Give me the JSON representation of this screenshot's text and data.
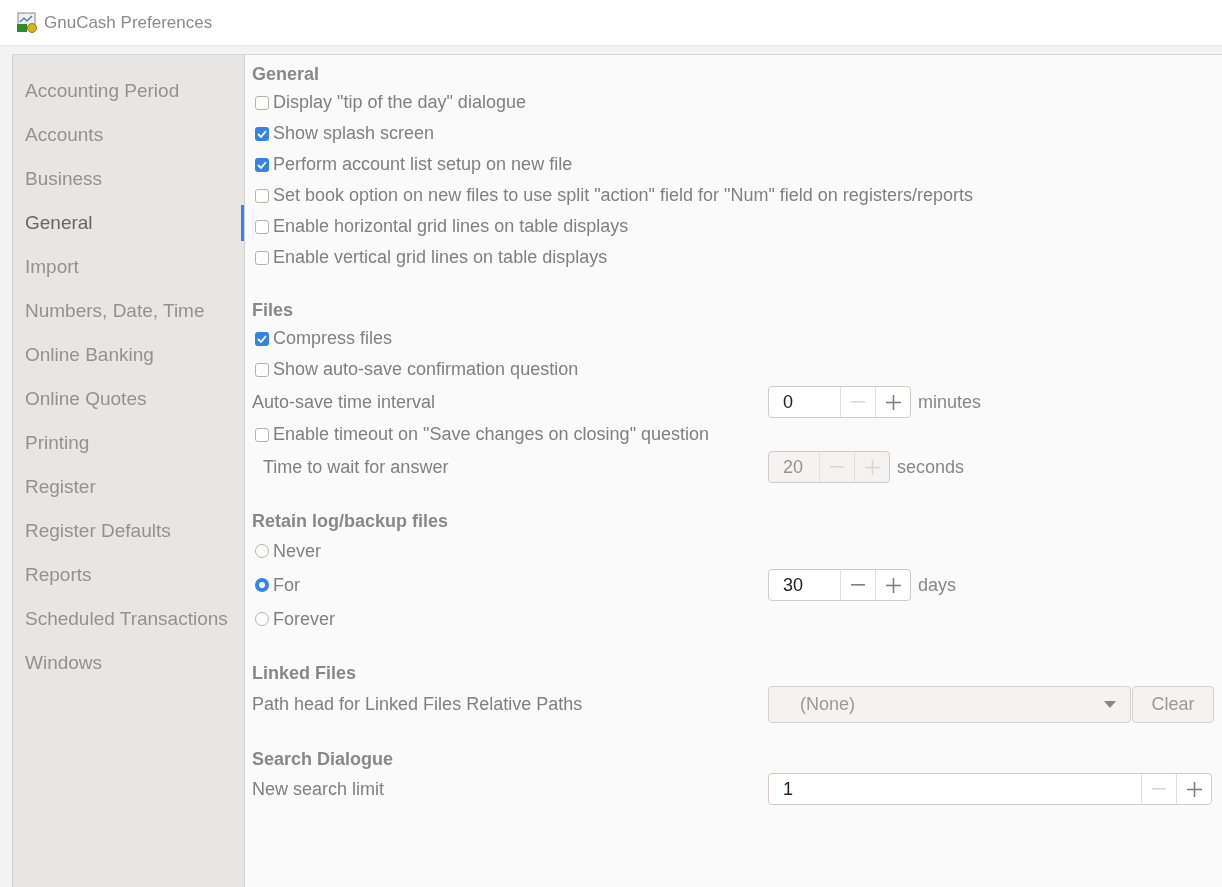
{
  "window": {
    "title": "GnuCash Preferences"
  },
  "sidebar": {
    "items": [
      {
        "label": "Accounting Period",
        "selected": false
      },
      {
        "label": "Accounts",
        "selected": false
      },
      {
        "label": "Business",
        "selected": false
      },
      {
        "label": "General",
        "selected": true
      },
      {
        "label": "Import",
        "selected": false
      },
      {
        "label": "Numbers, Date, Time",
        "selected": false
      },
      {
        "label": "Online Banking",
        "selected": false
      },
      {
        "label": "Online Quotes",
        "selected": false
      },
      {
        "label": "Printing",
        "selected": false
      },
      {
        "label": "Register",
        "selected": false
      },
      {
        "label": "Register Defaults",
        "selected": false
      },
      {
        "label": "Reports",
        "selected": false
      },
      {
        "label": "Scheduled Transactions",
        "selected": false
      },
      {
        "label": "Windows",
        "selected": false
      }
    ]
  },
  "sections": [
    {
      "title": "General",
      "rows": [
        {
          "kind": "checkbox",
          "label": "Display \"tip of the day\" dialogue",
          "checked": false
        },
        {
          "kind": "checkbox",
          "label": "Show splash screen",
          "checked": true
        },
        {
          "kind": "checkbox",
          "label": "Perform account list setup on new file",
          "checked": true
        },
        {
          "kind": "checkbox",
          "label": "Set book option on new files to use split \"action\" field for \"Num\" field on registers/reports",
          "checked": false
        },
        {
          "kind": "checkbox",
          "label": "Enable horizontal grid lines on table displays",
          "checked": false
        },
        {
          "kind": "checkbox",
          "label": "Enable vertical grid lines on table displays",
          "checked": false
        }
      ]
    },
    {
      "title": "Files",
      "rows": [
        {
          "kind": "checkbox",
          "label": "Compress files",
          "checked": true
        },
        {
          "kind": "checkbox",
          "label": "Show auto-save confirmation question",
          "checked": false
        },
        {
          "kind": "spin",
          "label": "Auto-save time interval",
          "value": "0",
          "unit": "minutes",
          "disabled": false,
          "minus_disabled": true,
          "indented": false
        },
        {
          "kind": "checkbox",
          "label": "Enable timeout on \"Save changes on closing\" question",
          "checked": false
        },
        {
          "kind": "spin",
          "label": "Time to wait for answer",
          "value": "20",
          "unit": "seconds",
          "disabled": true,
          "minus_disabled": true,
          "indented": true
        }
      ]
    },
    {
      "title": "Retain log/backup files",
      "rows": [
        {
          "kind": "radio",
          "label": "Never",
          "selected": false
        },
        {
          "kind": "radio",
          "label": "For",
          "selected": true,
          "value": "30",
          "unit": "days",
          "minus_disabled": false
        },
        {
          "kind": "radio",
          "label": "Forever",
          "selected": false
        }
      ]
    },
    {
      "title": "Linked Files",
      "rows": [
        {
          "kind": "combo",
          "label": "Path head for Linked Files Relative Paths",
          "value": "(None)",
          "button": "Clear"
        }
      ]
    },
    {
      "title": "Search Dialogue",
      "rows": [
        {
          "kind": "widespin",
          "label": "New search limit",
          "value": "1",
          "minus_disabled": true
        }
      ]
    }
  ]
}
